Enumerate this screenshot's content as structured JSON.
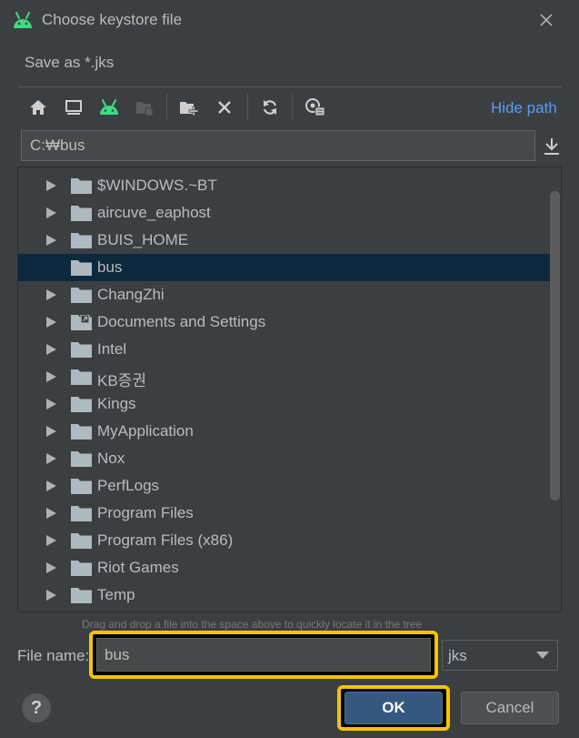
{
  "dialog": {
    "title": "Choose keystore file",
    "subtitle": "Save as *.jks",
    "icon": "android-icon"
  },
  "toolbar": {
    "buttons": [
      "home-icon",
      "desktop-icon",
      "android-project-icon",
      "module-icon",
      "new-folder-icon",
      "delete-icon",
      "refresh-icon",
      "show-hidden-icon"
    ],
    "hide_path_label": "Hide path"
  },
  "path": {
    "value": "C:₩bus"
  },
  "tree": {
    "items": [
      {
        "label": "$WINDOWS.~BT",
        "expandable": true,
        "selected": false,
        "icon": "folder-icon"
      },
      {
        "label": "aircuve_eaphost",
        "expandable": true,
        "selected": false,
        "icon": "folder-icon"
      },
      {
        "label": "BUIS_HOME",
        "expandable": true,
        "selected": false,
        "icon": "folder-icon"
      },
      {
        "label": "bus",
        "expandable": false,
        "selected": true,
        "icon": "folder-icon"
      },
      {
        "label": "ChangZhi",
        "expandable": true,
        "selected": false,
        "icon": "folder-icon"
      },
      {
        "label": "Documents and Settings",
        "expandable": true,
        "selected": false,
        "icon": "folder-link-icon"
      },
      {
        "label": "Intel",
        "expandable": true,
        "selected": false,
        "icon": "folder-icon"
      },
      {
        "label": "KB증권",
        "expandable": true,
        "selected": false,
        "icon": "folder-icon"
      },
      {
        "label": "Kings",
        "expandable": true,
        "selected": false,
        "icon": "folder-icon"
      },
      {
        "label": "MyApplication",
        "expandable": true,
        "selected": false,
        "icon": "folder-icon"
      },
      {
        "label": "Nox",
        "expandable": true,
        "selected": false,
        "icon": "folder-icon"
      },
      {
        "label": "PerfLogs",
        "expandable": true,
        "selected": false,
        "icon": "folder-icon"
      },
      {
        "label": "Program Files",
        "expandable": true,
        "selected": false,
        "icon": "folder-icon"
      },
      {
        "label": "Program Files (x86)",
        "expandable": true,
        "selected": false,
        "icon": "folder-icon"
      },
      {
        "label": "Riot Games",
        "expandable": true,
        "selected": false,
        "icon": "folder-icon"
      },
      {
        "label": "Temp",
        "expandable": true,
        "selected": false,
        "icon": "folder-icon"
      }
    ],
    "hint": "Drag and drop a file into the space above to quickly locate it in the tree"
  },
  "footer": {
    "file_name_label": "File name:",
    "file_name_value": "bus",
    "file_type_value": "jks",
    "ok_label": "OK",
    "cancel_label": "Cancel",
    "help_label": "?"
  },
  "colors": {
    "background": "#3c3f41",
    "selection": "#0d293e",
    "accent_link": "#589df6",
    "highlight": "#f5c400",
    "ok_button": "#365880",
    "android_green": "#3ddc84"
  }
}
